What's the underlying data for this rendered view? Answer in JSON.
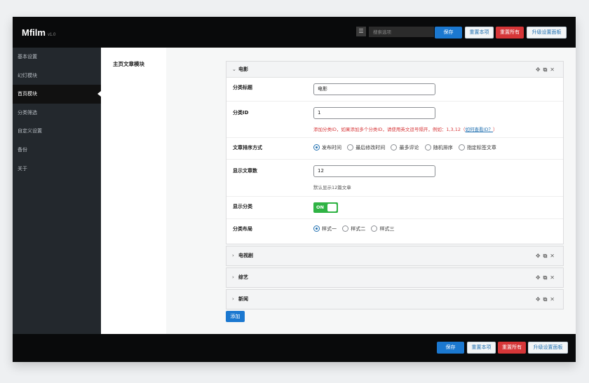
{
  "app": {
    "name": "Mfilm",
    "version": "v1.0"
  },
  "header": {
    "search_placeholder": "搜索选项",
    "save": "保存",
    "reset_section": "重置本项",
    "reset_all": "重置所有",
    "upgrade": "升级设置面板"
  },
  "sidebar": {
    "items": [
      {
        "label": "基本设置"
      },
      {
        "label": "幻灯模块"
      },
      {
        "label": "首页模块"
      },
      {
        "label": "分类筛选"
      },
      {
        "label": "自定义设置"
      },
      {
        "label": "备份"
      },
      {
        "label": "关于"
      }
    ],
    "active": "首页模块"
  },
  "main": {
    "section_label": "主页文章模块",
    "open_panel": {
      "title": "电影",
      "rows": {
        "category_title": {
          "label": "分类标题",
          "value": "电影"
        },
        "category_id": {
          "label": "分类ID",
          "value": "1",
          "help": "添加分类ID，如果添加多个分类ID，请使用英文逗号隔开，例如：1,3,12",
          "help_open": "（",
          "help_link": "如何查看ID？",
          "help_close": "）"
        },
        "sort": {
          "label": "文章排序方式",
          "options": [
            "发布时间",
            "最后修改时间",
            "最多评论",
            "随机排序",
            "指定标签文章"
          ],
          "selected": "发布时间"
        },
        "post_count": {
          "label": "显示文章数",
          "value": "12",
          "help": "默认显示12篇文章"
        },
        "show_category": {
          "label": "显示分类",
          "toggle_label": "ON",
          "enabled": true
        },
        "layout": {
          "label": "分类布局",
          "options": [
            "样式一",
            "样式二",
            "样式三"
          ],
          "selected": "样式一"
        }
      }
    },
    "collapsed_panels": [
      {
        "title": "电视剧"
      },
      {
        "title": "综艺"
      },
      {
        "title": "新闻"
      }
    ],
    "panel_icons": [
      "move-icon",
      "copy-icon",
      "close-icon"
    ],
    "add_button": "添加"
  },
  "footer": {
    "save": "保存",
    "reset_section": "重置本项",
    "reset_all": "重置所有",
    "upgrade": "升级设置面板"
  }
}
